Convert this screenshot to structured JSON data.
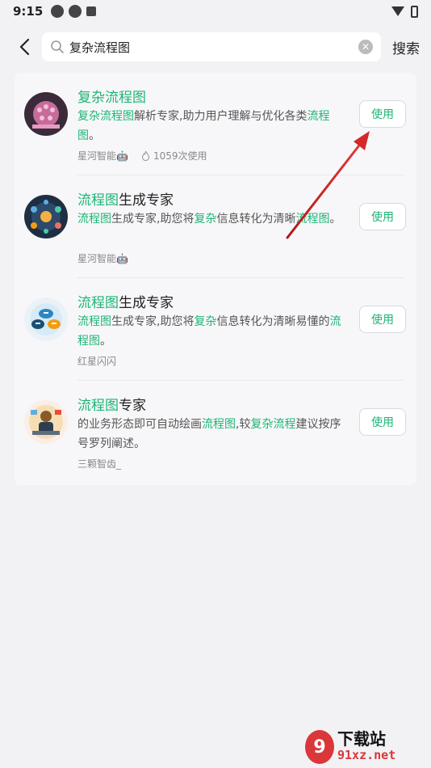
{
  "status": {
    "time": "9:15"
  },
  "search": {
    "query": "复杂流程图",
    "button_label": "搜索"
  },
  "results": [
    {
      "title_parts": [
        {
          "text": "复杂流程图",
          "hl": true
        }
      ],
      "desc_parts": [
        {
          "text": "复杂流程图",
          "hl": true
        },
        {
          "text": "解析专家,助力用户理解与优化各类",
          "hl": false
        },
        {
          "text": "流程图",
          "hl": true
        },
        {
          "text": "。",
          "hl": false
        }
      ],
      "author": "星河智能🤖",
      "uses": "1059次使用",
      "button": "使用"
    },
    {
      "title_parts": [
        {
          "text": "流程图",
          "hl": true
        },
        {
          "text": "生成专家",
          "hl": false
        }
      ],
      "desc_parts": [
        {
          "text": "流程图",
          "hl": true
        },
        {
          "text": "生成专家,助您将",
          "hl": false
        },
        {
          "text": "复杂",
          "hl": true
        },
        {
          "text": "信息转化为清晰",
          "hl": false
        },
        {
          "text": "流程图",
          "hl": true
        },
        {
          "text": "。",
          "hl": false
        }
      ],
      "author": "星河智能🤖",
      "uses": "",
      "button": "使用"
    },
    {
      "title_parts": [
        {
          "text": "流程图",
          "hl": true
        },
        {
          "text": "生成专家",
          "hl": false
        }
      ],
      "desc_parts": [
        {
          "text": "流程图",
          "hl": true
        },
        {
          "text": "生成专家,助您将",
          "hl": false
        },
        {
          "text": "复杂",
          "hl": true
        },
        {
          "text": "信息转化为清晰易懂的",
          "hl": false
        },
        {
          "text": "流程图",
          "hl": true
        },
        {
          "text": "。",
          "hl": false
        }
      ],
      "author": "红星闪闪",
      "uses": "",
      "button": "使用"
    },
    {
      "title_parts": [
        {
          "text": "流程图",
          "hl": true
        },
        {
          "text": "专家",
          "hl": false
        }
      ],
      "desc_parts": [
        {
          "text": "的业务形态即可自动绘画",
          "hl": false
        },
        {
          "text": "流程图",
          "hl": true
        },
        {
          "text": ",较",
          "hl": false
        },
        {
          "text": "复杂流程",
          "hl": true
        },
        {
          "text": "建议按序号罗列阐述。",
          "hl": false
        }
      ],
      "author": "三颗智齿_",
      "uses": "",
      "button": "使用"
    }
  ],
  "watermark": {
    "logo": "9",
    "top": "下载站",
    "bottom": "91xz.net"
  },
  "colors": {
    "accent": "#1cb574",
    "arrow": "#d22a2a"
  },
  "icons": {
    "back": "chevron-left-icon",
    "search": "search-icon",
    "clear": "clear-icon",
    "uses": "flame-icon"
  }
}
